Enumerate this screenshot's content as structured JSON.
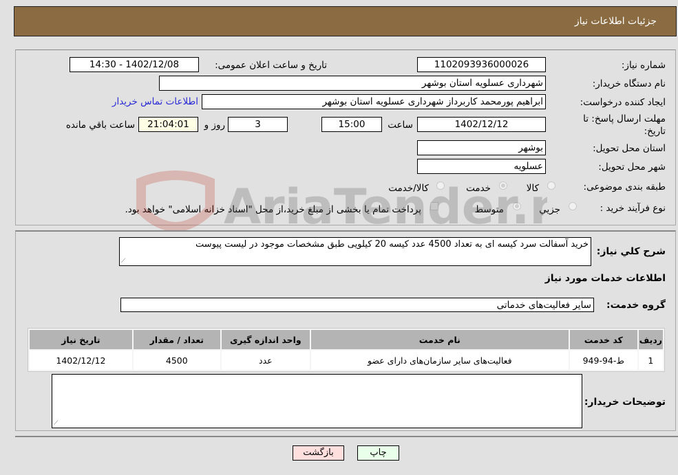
{
  "header": {
    "title": "جزئیات اطلاعات نیاز"
  },
  "form": {
    "need_number": {
      "label": "شماره نیاز:",
      "value": "1102093936000026"
    },
    "announce_datetime": {
      "label": "تاریخ و ساعت اعلان عمومی:",
      "value": "1402/12/08 - 14:30"
    },
    "buyer_org": {
      "label": "نام دستگاه خریدار:",
      "value": "شهرداری عسلویه استان بوشهر"
    },
    "requester": {
      "label": "ایجاد کننده درخواست:",
      "value": "ابراهیم پورمحمد کاربرداز شهرداری عسلویه استان بوشهر"
    },
    "buyer_contact_link": "اطلاعات تماس خریدار",
    "deadline": {
      "label_line1": "مهلت ارسال پاسخ: تا",
      "label_line2": "تاریخ:",
      "date": "1402/12/12",
      "time_label": "ساعت",
      "time": "15:00",
      "days": "3",
      "days_label": "روز و",
      "remaining": "21:04:01",
      "remaining_label": "ساعت باقي مانده"
    },
    "province": {
      "label": "استان محل تحویل:",
      "value": "بوشهر"
    },
    "city": {
      "label": "شهر محل تحویل:",
      "value": "عسلویه"
    },
    "category": {
      "label": "طبقه بندی موضوعی:",
      "options": [
        "کالا",
        "خدمت",
        "کالا/خدمت"
      ],
      "selected": "خدمت"
    },
    "purchase_process": {
      "label": "نوع فرآیند خرید :",
      "options": [
        "جزیي",
        "متوسط"
      ],
      "selected": "متوسط",
      "note": "پرداخت تمام یا بخشی از مبلغ خرید،از محل \"اسناد خزانه اسلامی\" خواهد بود."
    }
  },
  "details": {
    "description_label": "شرح كلي نياز:",
    "description": "خرید آسفالت سرد کیسه ای به تعداد 4500 عدد کیسه 20 کیلویی طبق مشخصات موجود در لیست پیوست",
    "services_heading": "اطلاعات خدمات مورد نیاز",
    "service_group_label": "گروه خدمت:",
    "service_group": "سایر فعالیت‌های خدماتی",
    "table": {
      "headers": [
        "ردیف",
        "کد خدمت",
        "نام خدمت",
        "واحد اندازه گیری",
        "تعداد / مقدار",
        "تاریخ نیاز"
      ],
      "rows": [
        [
          "1",
          "ط-94-949",
          "فعالیت‌های سایر سازمان‌های دارای عضو",
          "عدد",
          "4500",
          "1402/12/12"
        ]
      ]
    },
    "buyer_notes_label": "توضیحات خریدار:",
    "buyer_notes": ""
  },
  "buttons": {
    "print": "چاپ",
    "back": "بازگشت"
  },
  "watermark": {
    "text": "AriaTender.neT"
  }
}
